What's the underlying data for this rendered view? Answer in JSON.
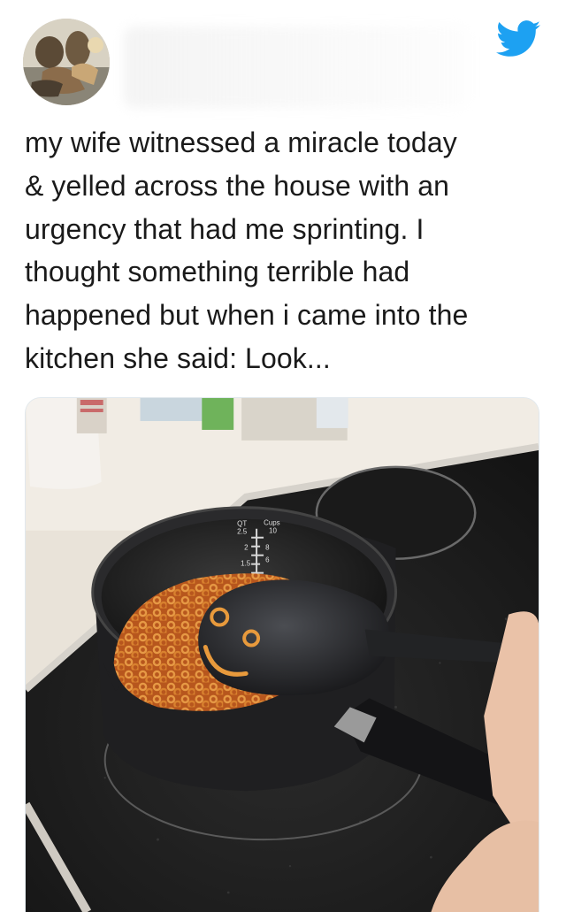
{
  "tweet": {
    "text_lines": [
      "my wife witnessed a miracle today",
      "& yelled across the house with an",
      "urgency that had me sprinting. I",
      "thought something terrible had",
      "happened but when i came into the",
      "kitchen she said: Look..."
    ]
  },
  "media": {
    "measuring_cup_units": [
      "QT",
      "Cups"
    ],
    "measuring_cup_numbers": [
      "2.5",
      "10",
      "2",
      "8",
      "6",
      "1.5"
    ]
  },
  "colors": {
    "twitter_blue": "#1DA1F2",
    "text": "#1a1a1a",
    "card_bg": "#ffffff"
  },
  "icons": {
    "brand": "twitter-bird-icon"
  }
}
